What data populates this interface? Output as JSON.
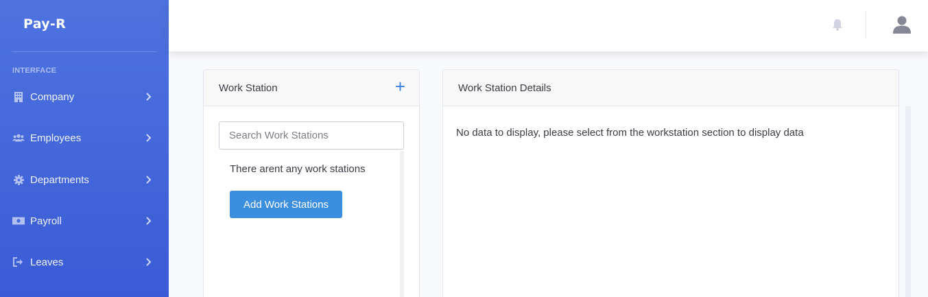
{
  "sidebar": {
    "brand": "Pay-R",
    "section_label": "INTERFACE",
    "items": [
      {
        "label": "Company",
        "icon": "building-icon"
      },
      {
        "label": "Employees",
        "icon": "users-icon"
      },
      {
        "label": "Departments",
        "icon": "gear-icon"
      },
      {
        "label": "Payroll",
        "icon": "money-icon"
      },
      {
        "label": "Leaves",
        "icon": "sign-out-icon"
      }
    ]
  },
  "topbar": {
    "notification_icon": "bell-icon",
    "user_icon": "user-icon"
  },
  "workstation": {
    "header": "Work Station",
    "add_icon": "+",
    "search_placeholder": "Search Work Stations",
    "empty_message": "There arent any work stations",
    "add_button": "Add Work Stations"
  },
  "details": {
    "header": "Work Station Details",
    "empty_message": "No data to display, please select from the workstation section to display data"
  },
  "colors": {
    "sidebar": "#4e73df",
    "primary_button": "#3b8fde",
    "accent": "#3b7ddd"
  }
}
